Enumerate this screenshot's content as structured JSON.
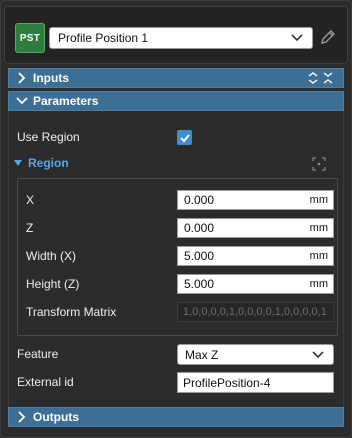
{
  "tool": {
    "badge": "PST",
    "name": "Profile Position 1"
  },
  "sections": {
    "inputs": "Inputs",
    "parameters": "Parameters",
    "outputs": "Outputs"
  },
  "params": {
    "use_region_label": "Use Region",
    "use_region_checked": true,
    "region_label": "Region",
    "x_label": "X",
    "x_value": "0.000",
    "z_label": "Z",
    "z_value": "0.000",
    "width_label": "Width (X)",
    "width_value": "5.000",
    "height_label": "Height (Z)",
    "height_value": "5.000",
    "unit": "mm",
    "transform_label": "Transform Matrix",
    "transform_value": "1,0,0,0,0,1,0,0,0,0,1,0,0,0,0,1",
    "feature_label": "Feature",
    "feature_value": "Max Z",
    "external_id_label": "External id",
    "external_id_value": "ProfilePosition-4"
  },
  "colors": {
    "accent": "#3c6f93",
    "badge": "#2f7d3c",
    "region_header": "#58a6e8",
    "checkbox": "#3d8ed0"
  },
  "icons": {
    "section_closed": "chevron-right-icon",
    "section_open": "chevron-down-icon",
    "expand_collapse": "expand-collapse-icon",
    "edit": "pencil-icon",
    "region_center": "crosshair-icon"
  }
}
